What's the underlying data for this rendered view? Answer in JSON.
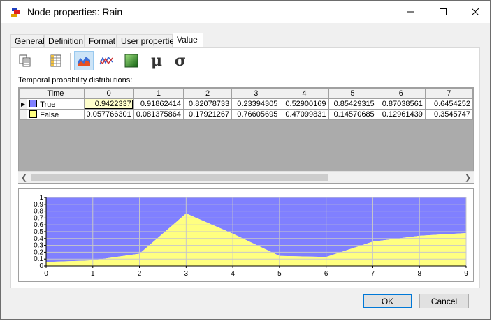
{
  "window": {
    "title": "Node properties: Rain",
    "minimize_icon": "minimize-icon",
    "maximize_icon": "maximize-icon",
    "close_icon": "close-icon"
  },
  "tabs": [
    {
      "label": "General",
      "active": false
    },
    {
      "label": "Definition",
      "active": false
    },
    {
      "label": "Format",
      "active": false
    },
    {
      "label": "User properties",
      "active": false
    },
    {
      "label": "Value",
      "active": true
    }
  ],
  "toolbar": {
    "items": [
      {
        "icon": "copy-icon"
      },
      {
        "icon": "spreadsheet-icon"
      },
      {
        "icon": "area-chart-icon",
        "selected": true
      },
      {
        "icon": "line-chart-icon"
      },
      {
        "icon": "green-square-icon"
      },
      {
        "icon": "mu-icon",
        "glyph": "μ"
      },
      {
        "icon": "sigma-icon",
        "glyph": "σ"
      }
    ]
  },
  "section_label": "Temporal probability distributions:",
  "grid": {
    "corner_header": "Time",
    "columns": [
      "0",
      "1",
      "2",
      "3",
      "4",
      "5",
      "6",
      "7"
    ],
    "rows": [
      {
        "name": "True",
        "color": "#8080ff",
        "values": [
          "0.9422337",
          "0.91862414",
          "0.82078733",
          "0.23394305",
          "0.52900169",
          "0.85429315",
          "0.87038561",
          "0.6454252"
        ]
      },
      {
        "name": "False",
        "color": "#ffff80",
        "values": [
          "0.057766301",
          "0.081375864",
          "0.17921267",
          "0.76605695",
          "0.47099831",
          "0.14570685",
          "0.12961439",
          "0.3545747"
        ]
      }
    ],
    "selected_row": 0,
    "selected_col": 0
  },
  "chart_data": {
    "type": "area",
    "x": [
      0,
      1,
      2,
      3,
      4,
      5,
      6,
      7,
      8,
      9
    ],
    "series": [
      {
        "name": "False",
        "color": "#ffff80",
        "values": [
          0.058,
          0.081,
          0.179,
          0.766,
          0.471,
          0.146,
          0.13,
          0.355,
          0.44,
          0.48
        ]
      },
      {
        "name": "True",
        "color": "#8080ff",
        "values": [
          0.942,
          0.919,
          0.821,
          0.234,
          0.529,
          0.854,
          0.87,
          0.645,
          0.56,
          0.52
        ]
      }
    ],
    "stacked": true,
    "ylim": [
      0,
      1
    ],
    "xlim": [
      0,
      9
    ],
    "y_ticks": [
      "0",
      "0.1",
      "0.2",
      "0.3",
      "0.4",
      "0.5",
      "0.6",
      "0.7",
      "0.8",
      "0.9",
      "1"
    ],
    "x_ticks": [
      "0",
      "1",
      "2",
      "3",
      "4",
      "5",
      "6",
      "7",
      "8",
      "9"
    ],
    "grid": true,
    "title": "",
    "xlabel": "",
    "ylabel": ""
  },
  "buttons": {
    "ok": "OK",
    "cancel": "Cancel"
  }
}
